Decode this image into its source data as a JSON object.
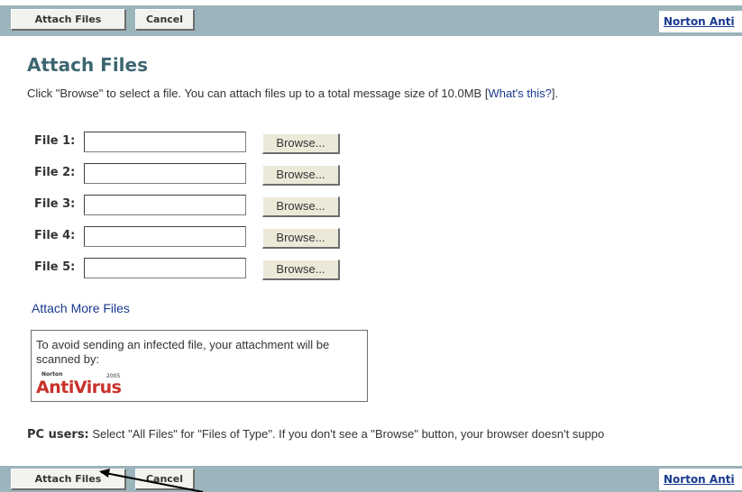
{
  "toolbar_top": {
    "attach_label": "Attach Files",
    "cancel_label": "Cancel",
    "norton_link": "Norton Anti"
  },
  "page": {
    "title": "Attach Files",
    "intro_text": "Click \"Browse\" to select a file. You can attach files up to a total message size of 10.0MB [",
    "intro_link": "What's this?",
    "intro_end": "]."
  },
  "file_rows": [
    {
      "label": "File 1:",
      "value": "",
      "button": "Browse..."
    },
    {
      "label": "File 2:",
      "value": "",
      "button": "Browse..."
    },
    {
      "label": "File 3:",
      "value": "",
      "button": "Browse..."
    },
    {
      "label": "File 4:",
      "value": "",
      "button": "Browse..."
    },
    {
      "label": "File 5:",
      "value": "",
      "button": "Browse..."
    }
  ],
  "attach_more": "Attach More Files",
  "scan_box": {
    "text": "To avoid sending an infected file, your attachment will be scanned by:",
    "logo_small": "Norton",
    "logo_year": "2005",
    "logo_word": "AntiVirus"
  },
  "pc_note": {
    "bold": "PC users:",
    "text": " Select \"All Files\" for \"Files of Type\". If you don't see a \"Browse\" button, your browser doesn't suppo"
  },
  "toolbar_bottom": {
    "attach_label": "Attach Files",
    "cancel_label": "Cancel",
    "norton_link": "Norton Anti"
  },
  "colors": {
    "toolbar_bg": "#9cb4bb",
    "title": "#3d6670",
    "link": "#1a3a8f",
    "antivirus_red": "#c8312a"
  },
  "icons": [
    "mouse-arrow-icon"
  ]
}
